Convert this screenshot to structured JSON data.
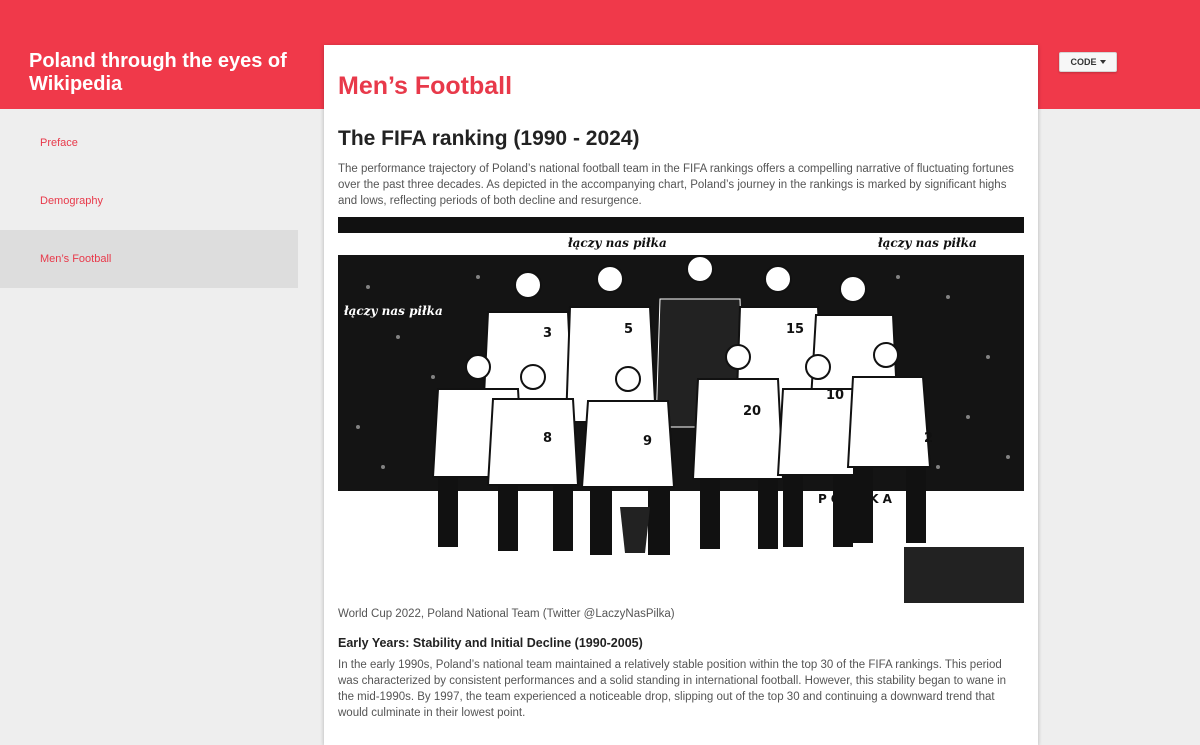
{
  "site": {
    "title": "Poland through the eyes of Wikipedia"
  },
  "sidebar": {
    "items": [
      {
        "label": "Preface"
      },
      {
        "label": "Demography"
      },
      {
        "label": "Men’s Football"
      }
    ]
  },
  "toolbar": {
    "code_label": "CODE"
  },
  "main": {
    "page_title": "Men’s Football",
    "section_title": "The FIFA ranking (1990 - 2024)",
    "intro": "The performance trajectory of Poland’s national football team in the FIFA rankings offers a compelling narrative of fluctuating fortunes over the past three decades. As depicted in the accompanying chart, Poland’s journey in the rankings is marked by significant highs and lows, reflecting periods of both decline and resurgence.",
    "image": {
      "banner_text_left": "łączy nas piłka",
      "banner_text_right": "łączy nas piłka",
      "side_text": "łączy nas piłka",
      "board_text": "POLSKA",
      "jersey_numbers": [
        "3",
        "5",
        "15",
        "8",
        "9",
        "20",
        "10",
        "2"
      ]
    },
    "caption": "World Cup 2022, Poland National Team (Twitter @LaczyNasPilka)",
    "subsection_title": "Early Years: Stability and Initial Decline (1990-2005)",
    "subsection_text": "In the early 1990s, Poland’s national team maintained a relatively stable position within the top 30 of the FIFA rankings. This period was characterized by consistent performances and a solid standing in international football. However, this stability began to wane in the mid-1990s. By 1997, the team experienced a noticeable drop, slipping out of the top 30 and continuing a downward trend that would culminate in their lowest point."
  }
}
